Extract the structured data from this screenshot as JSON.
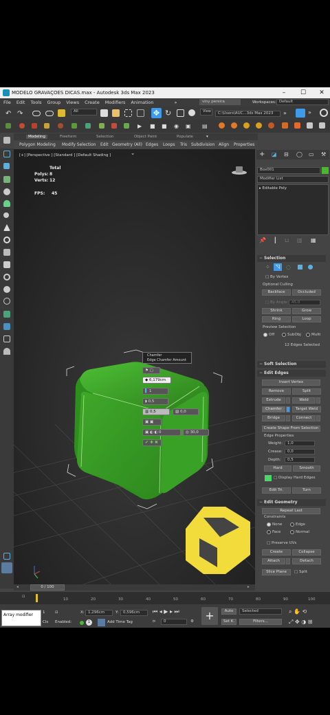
{
  "window": {
    "title": "MODELO GRAVAÇOES DICAS.max - Autodesk 3ds Max 2023",
    "controls": [
      "–",
      "☐",
      "✕"
    ]
  },
  "menubar": {
    "items": [
      "File",
      "Edit",
      "Tools",
      "Group",
      "Views",
      "Create",
      "Modifiers",
      "Animation"
    ],
    "more": "»",
    "user": "viny pereira",
    "workspaces_label": "Workspaces:",
    "workspaces_value": "Default"
  },
  "toolbar": {
    "selection_filter": "All",
    "view_label": "View",
    "path": "C:\\Users\\AUC...3ds Max 2023"
  },
  "ribbon": {
    "tabs": [
      "Modeling",
      "Freeform",
      "Selection",
      "Object Paint",
      "Populate"
    ],
    "subtabs": [
      "Polygon Modeling",
      "Modify Selection",
      "Edit",
      "Geometry (All)",
      "Edges",
      "Loops",
      "Tris",
      "Subdivision",
      "Align",
      "Properties"
    ]
  },
  "viewport": {
    "label": "[+] [Perspective ] [Standard ] [Default Shading ]",
    "stats": {
      "total_label": "Total",
      "polys_label": "Polys:",
      "polys": "8",
      "verts_label": "Verts:",
      "verts": "12",
      "fps_label": "FPS:",
      "fps": "45"
    },
    "chamfer_tooltip": {
      "title": "Chamfer",
      "subtitle": "Edge Chamfer Amount"
    },
    "caddy": {
      "amount": "6,179cm",
      "segments": "1",
      "tension": "0,5",
      "depth": "0,5",
      "end_bias": "0,0",
      "angle": "0",
      "smooth": "30,0"
    }
  },
  "command_panel": {
    "object_name": "Box001",
    "modifier_list": "Modifier List",
    "stack": [
      "Editable Poly"
    ],
    "selection": {
      "title": "Selection",
      "by_vertex": "By Vertex",
      "ignore_backfacing": "Optional Culling",
      "backface": "Backface",
      "occluded": "Occluded",
      "by_angle_label": "By Angle:",
      "by_angle_value": "45,0",
      "shrink": "Shrink",
      "grow": "Grow",
      "ring": "Ring",
      "loop": "Loop",
      "preview_label": "Preview Selection",
      "preview_options": [
        "Off",
        "SubObj",
        "Multi"
      ],
      "status": "12 Edges Selected"
    },
    "soft_selection": {
      "title": "Soft Selection"
    },
    "edit_edges": {
      "title": "Edit Edges",
      "insert_vertex": "Insert Vertex",
      "remove": "Remove",
      "split": "Split",
      "extrude": "Extrude",
      "weld": "Weld",
      "chamfer": "Chamfer",
      "target_weld": "Target Weld",
      "bridge": "Bridge",
      "connect": "Connect",
      "create_shape": "Create Shape From Selection",
      "edge_props": "Edge Properties",
      "weight_label": "Weight:",
      "weight": "1,0",
      "crease_label": "Crease:",
      "crease": "0,0",
      "depth_label": "Depth:",
      "depth": "0,5",
      "hard": "Hard",
      "smooth": "Smooth",
      "display_hard": "Display Hard Edges",
      "edit_tri": "Edit Tri.",
      "turn": "Turn"
    },
    "edit_geometry": {
      "title": "Edit Geometry",
      "repeat_last": "Repeat Last",
      "constraints_label": "Constraints",
      "constraint_options": [
        "None",
        "Edge",
        "Face",
        "Normal"
      ],
      "preserve_uvs": "Preserve UVs",
      "create": "Create",
      "collapse": "Collapse",
      "attach": "Attach",
      "detach": "Detach",
      "slice_plane": "Slice Plane",
      "split": "Split"
    }
  },
  "timeline": {
    "frame_label": "0 / 100",
    "ticks": [
      "10",
      "20",
      "30",
      "40",
      "50",
      "60",
      "70",
      "80",
      "90",
      "100"
    ]
  },
  "status_bar": {
    "script_text": "Array modifier",
    "x_label": "X:",
    "x_value": "1,296cm",
    "y_label": "Y:",
    "y_value": "0,596cm",
    "enabled_label": "Enabled:",
    "add_time_tag": "Add Time Tag",
    "auto_label": "Auto",
    "selected_label": "Selected",
    "setk_label": "Set K.",
    "filters_label": "Filters...",
    "frame_value": "0",
    "cls_label": "Cls",
    "scene_count": "1"
  },
  "colors": {
    "accent": "#3d9be9",
    "object_green": "#4db82f",
    "logo_yellow": "#f2dc3b"
  }
}
